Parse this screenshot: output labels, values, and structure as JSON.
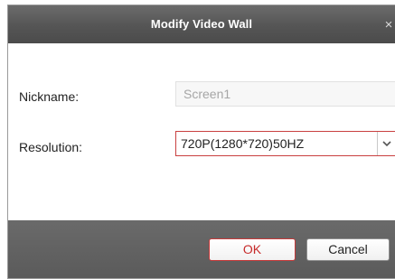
{
  "dialog": {
    "title": "Modify Video Wall",
    "close_glyph": "×",
    "close_icon": "close-icon"
  },
  "form": {
    "nickname": {
      "label": "Nickname:",
      "value": "Screen1"
    },
    "resolution": {
      "label": "Resolution:",
      "selected": "720P(1280*720)50HZ",
      "dropdown_icon": "chevron-down-icon"
    }
  },
  "buttons": {
    "ok_label": "OK",
    "cancel_label": "Cancel"
  },
  "colors": {
    "title_bar": "#555555",
    "footer": "#5f5f5f",
    "accent": "#c94040"
  }
}
